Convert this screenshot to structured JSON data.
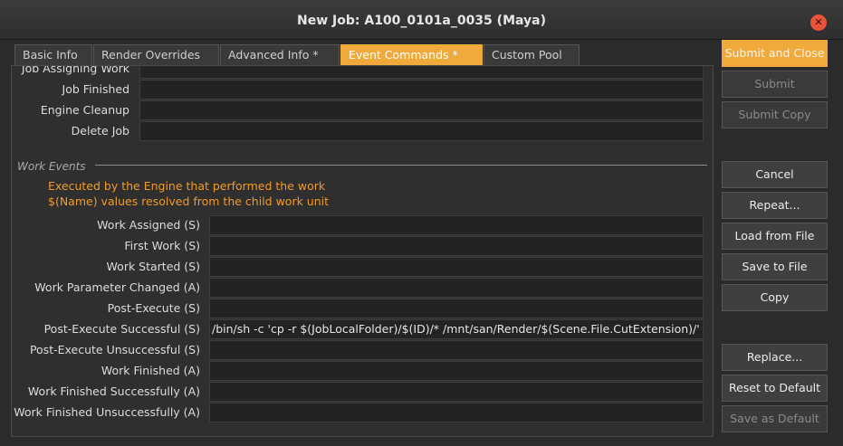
{
  "window": {
    "title": "New Job: A100_0101a_0035 (Maya)",
    "close_icon": "✕"
  },
  "tabs": [
    {
      "label": "Basic Info"
    },
    {
      "label": "Render Overrides"
    },
    {
      "label": "Advanced Info *"
    },
    {
      "label": "Event Commands *"
    },
    {
      "label": "Custom Pool"
    }
  ],
  "job_events": {
    "partial_label": "Job Assigning Work",
    "rows": [
      {
        "label": "Job Finished",
        "value": ""
      },
      {
        "label": "Engine Cleanup",
        "value": ""
      },
      {
        "label": "Delete Job",
        "value": ""
      }
    ]
  },
  "work_events": {
    "section_title": "Work Events",
    "note_line1": "Executed by the Engine that performed the work",
    "note_line2": "$(Name) values resolved from the child work unit",
    "rows": [
      {
        "label": "Work Assigned (S)",
        "value": ""
      },
      {
        "label": "First Work (S)",
        "value": ""
      },
      {
        "label": "Work Started (S)",
        "value": ""
      },
      {
        "label": "Work Parameter Changed (A)",
        "value": ""
      },
      {
        "label": "Post-Execute (S)",
        "value": ""
      },
      {
        "label": "Post-Execute Successful (S)",
        "value": "/bin/sh -c 'cp -r $(JobLocalFolder)/$(ID)/* /mnt/san/Render/$(Scene.File.CutExtension)/'"
      },
      {
        "label": "Post-Execute Unsuccessful (S)",
        "value": ""
      },
      {
        "label": "Work Finished (A)",
        "value": ""
      },
      {
        "label": "Work Finished Successfully (A)",
        "value": ""
      },
      {
        "label": "Work Finished Unsuccessfully (A)",
        "value": ""
      }
    ]
  },
  "buttons": {
    "submit_and_close": "Submit and Close",
    "submit": "Submit",
    "submit_copy": "Submit Copy",
    "cancel": "Cancel",
    "repeat": "Repeat...",
    "load_from_file": "Load from File",
    "save_to_file": "Save to File",
    "copy": "Copy",
    "replace": "Replace...",
    "reset_to_default": "Reset to Default",
    "save_as_default": "Save as Default"
  },
  "colors": {
    "accent": "#f0a93b",
    "note_text": "#f09a2a",
    "close_button": "#e8543a"
  }
}
